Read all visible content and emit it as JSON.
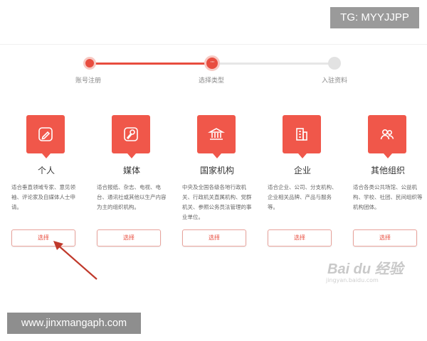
{
  "watermark_top": "TG: MYYJJPP",
  "watermark_bottom": "www.jinxmangaph.com",
  "progress": {
    "current_marker": "···",
    "steps": [
      "账号注册",
      "选择类型",
      "入驻资料"
    ]
  },
  "colors": {
    "accent": "#e84d3f",
    "inactive": "#e2e2e2"
  },
  "cards": [
    {
      "icon": "pencil-icon",
      "title": "个人",
      "description": "适合垂直领域专家、意见领袖、评论家及自媒体人士申请。",
      "button": "选择"
    },
    {
      "icon": "microphone-icon",
      "title": "媒体",
      "description": "适合报纸、杂志、电视、电台、通讯社或其他以生产内容为主的组织机构。",
      "button": "选择"
    },
    {
      "icon": "institution-icon",
      "title": "国家机构",
      "description": "中央及全国各级各地行政机关、行政机关直属机构、党群机关、参照公务员法管理的事业单位。",
      "button": "选择"
    },
    {
      "icon": "building-icon",
      "title": "企业",
      "description": "适合企业、公司、分支机构、企业相关品牌、产品与服务等。",
      "button": "选择"
    },
    {
      "icon": "group-icon",
      "title": "其他组织",
      "description": "适合各类公共场馆、公益机构、学校、社团、民间组织等机构团体。",
      "button": "选择"
    }
  ],
  "baidu_watermark": "Bai du 经验",
  "baidu_watermark_sub": "jingyan.baidu.com"
}
